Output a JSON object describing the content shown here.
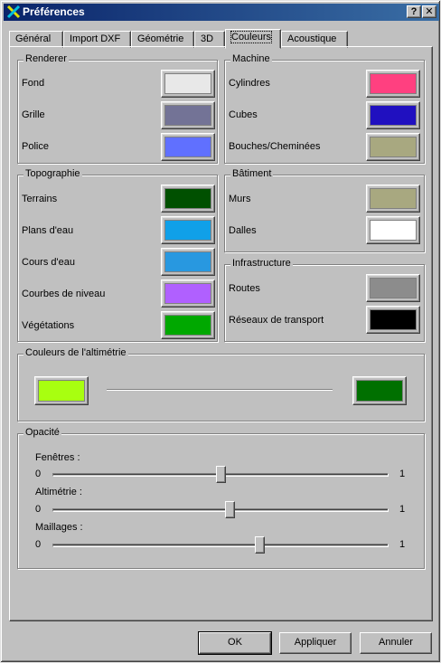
{
  "window": {
    "title": "Préférences",
    "help_label": "?",
    "close_label": "✕"
  },
  "tabs": [
    {
      "label": "Général"
    },
    {
      "label": "Import DXF"
    },
    {
      "label": "Géométrie"
    },
    {
      "label": "3D"
    },
    {
      "label": "Couleurs",
      "active": true
    },
    {
      "label": "Acoustique"
    }
  ],
  "renderer": {
    "title": "Renderer",
    "items": [
      {
        "label": "Fond",
        "color": "#e8e8e8"
      },
      {
        "label": "Grille",
        "color": "#737396"
      },
      {
        "label": "Police",
        "color": "#6070ff"
      }
    ]
  },
  "machine": {
    "title": "Machine",
    "items": [
      {
        "label": "Cylindres",
        "color": "#ff4080"
      },
      {
        "label": "Cubes",
        "color": "#2010c0"
      },
      {
        "label": "Bouches/Cheminées",
        "color": "#a8a880"
      }
    ]
  },
  "topographie": {
    "title": "Topographie",
    "items": [
      {
        "label": "Terrains",
        "color": "#005000"
      },
      {
        "label": "Plans d'eau",
        "color": "#10a0e8"
      },
      {
        "label": "Cours d'eau",
        "color": "#2898e0"
      },
      {
        "label": "Courbes de niveau",
        "color": "#b060ff"
      },
      {
        "label": "Végétations",
        "color": "#00a800"
      }
    ]
  },
  "batiment": {
    "title": "Bâtiment",
    "items": [
      {
        "label": "Murs",
        "color": "#a8a880"
      },
      {
        "label": "Dalles",
        "color": "#ffffff"
      }
    ]
  },
  "infrastructure": {
    "title": "Infrastructure",
    "items": [
      {
        "label": "Routes",
        "color": "#8c8c8c"
      },
      {
        "label": "Réseaux de transport",
        "color": "#000000"
      }
    ]
  },
  "altimetrie": {
    "title": "Couleurs de l'altimétrie",
    "start_color": "#a8ff10",
    "end_color": "#007000"
  },
  "opacite": {
    "title": "Opacité",
    "sliders": [
      {
        "label": "Fenêtres :",
        "min": "0",
        "max": "1",
        "value": 0.5
      },
      {
        "label": "Altimétrie :",
        "min": "0",
        "max": "1",
        "value": 0.53
      },
      {
        "label": "Maillages :",
        "min": "0",
        "max": "1",
        "value": 0.62
      }
    ]
  },
  "buttons": {
    "ok": "OK",
    "apply": "Appliquer",
    "cancel": "Annuler"
  }
}
